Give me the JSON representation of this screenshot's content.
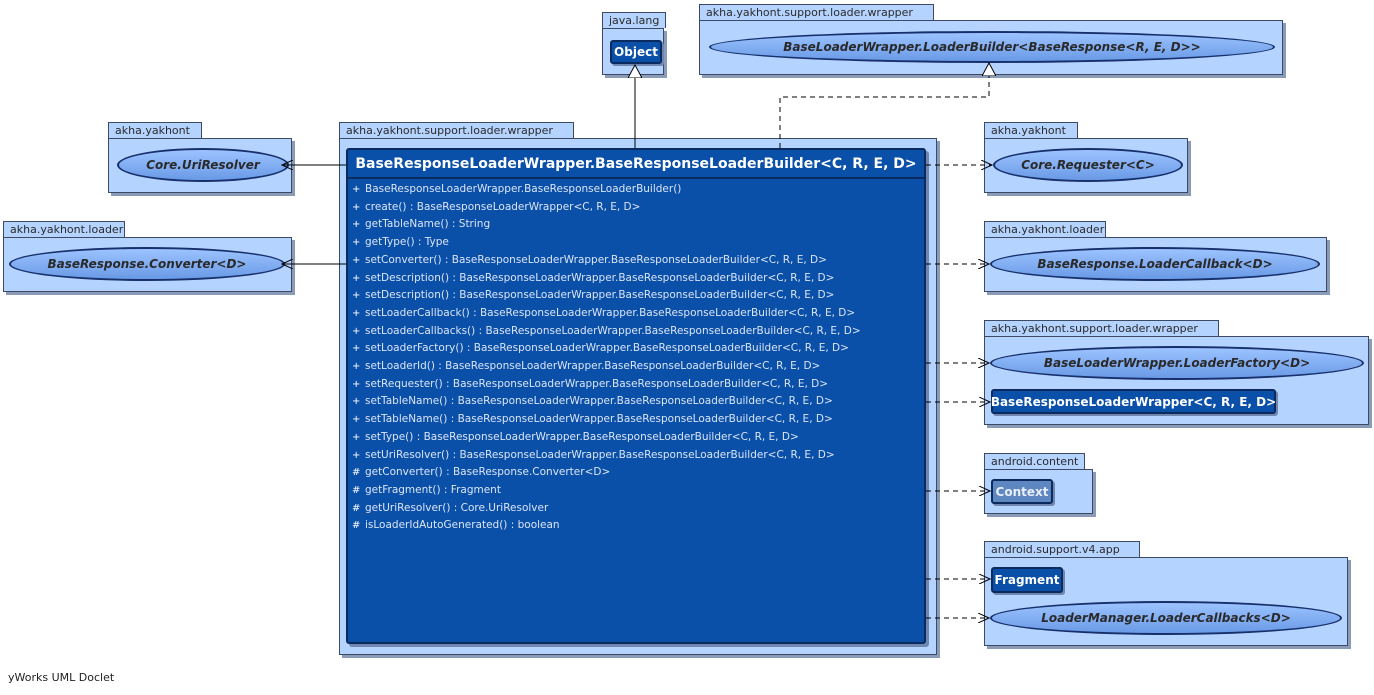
{
  "main_package": {
    "name": "akha.yakhont.support.loader.wrapper"
  },
  "main_class": {
    "title": "BaseResponseLoaderWrapper.BaseResponseLoaderBuilder<C, R, E, D>",
    "methods": [
      {
        "vis": "+",
        "text": "BaseResponseLoaderWrapper.BaseResponseLoaderBuilder()"
      },
      {
        "vis": "+",
        "text": "create() : BaseResponseLoaderWrapper<C, R, E, D>"
      },
      {
        "vis": "+",
        "text": "getTableName() : String"
      },
      {
        "vis": "+",
        "text": "getType() : Type"
      },
      {
        "vis": "+",
        "text": "setConverter() : BaseResponseLoaderWrapper.BaseResponseLoaderBuilder<C, R, E, D>"
      },
      {
        "vis": "+",
        "text": "setDescription() : BaseResponseLoaderWrapper.BaseResponseLoaderBuilder<C, R, E, D>"
      },
      {
        "vis": "+",
        "text": "setDescription() : BaseResponseLoaderWrapper.BaseResponseLoaderBuilder<C, R, E, D>"
      },
      {
        "vis": "+",
        "text": "setLoaderCallback() : BaseResponseLoaderWrapper.BaseResponseLoaderBuilder<C, R, E, D>"
      },
      {
        "vis": "+",
        "text": "setLoaderCallbacks() : BaseResponseLoaderWrapper.BaseResponseLoaderBuilder<C, R, E, D>"
      },
      {
        "vis": "+",
        "text": "setLoaderFactory() : BaseResponseLoaderWrapper.BaseResponseLoaderBuilder<C, R, E, D>"
      },
      {
        "vis": "+",
        "text": "setLoaderId() : BaseResponseLoaderWrapper.BaseResponseLoaderBuilder<C, R, E, D>"
      },
      {
        "vis": "+",
        "text": "setRequester() : BaseResponseLoaderWrapper.BaseResponseLoaderBuilder<C, R, E, D>"
      },
      {
        "vis": "+",
        "text": "setTableName() : BaseResponseLoaderWrapper.BaseResponseLoaderBuilder<C, R, E, D>"
      },
      {
        "vis": "+",
        "text": "setTableName() : BaseResponseLoaderWrapper.BaseResponseLoaderBuilder<C, R, E, D>"
      },
      {
        "vis": "+",
        "text": "setType() : BaseResponseLoaderWrapper.BaseResponseLoaderBuilder<C, R, E, D>"
      },
      {
        "vis": "+",
        "text": "setUriResolver() : BaseResponseLoaderWrapper.BaseResponseLoaderBuilder<C, R, E, D>"
      },
      {
        "vis": "#",
        "text": "getConverter() : BaseResponse.Converter<D>"
      },
      {
        "vis": "#",
        "text": "getFragment() : Fragment"
      },
      {
        "vis": "#",
        "text": "getUriResolver() : Core.UriResolver"
      },
      {
        "vis": "#",
        "text": "isLoaderIdAutoGenerated() : boolean"
      }
    ]
  },
  "packages": {
    "java_lang": {
      "name": "java.lang",
      "object": "Object"
    },
    "wrapper_top": {
      "name": "akha.yakhont.support.loader.wrapper",
      "iface": "BaseLoaderWrapper.LoaderBuilder<BaseResponse<R, E, D>>"
    },
    "yakhont_left": {
      "name": "akha.yakhont",
      "iface": "Core.UriResolver"
    },
    "loader_left": {
      "name": "akha.yakhont.loader",
      "iface": "BaseResponse.Converter<D>"
    },
    "yakhont_right": {
      "name": "akha.yakhont",
      "iface": "Core.Requester<C>"
    },
    "loader_right": {
      "name": "akha.yakhont.loader",
      "iface": "BaseResponse.LoaderCallback<D>"
    },
    "wrapper_right": {
      "name": "akha.yakhont.support.loader.wrapper",
      "iface": "BaseLoaderWrapper.LoaderFactory<D>",
      "cls": "BaseResponseLoaderWrapper<C, R, E, D>"
    },
    "android_content": {
      "name": "android.content",
      "cls": "Context"
    },
    "support_v4": {
      "name": "android.support.v4.app",
      "cls": "Fragment",
      "iface": "LoaderManager.LoaderCallbacks<D>"
    }
  },
  "footer": "yWorks UML Doclet"
}
